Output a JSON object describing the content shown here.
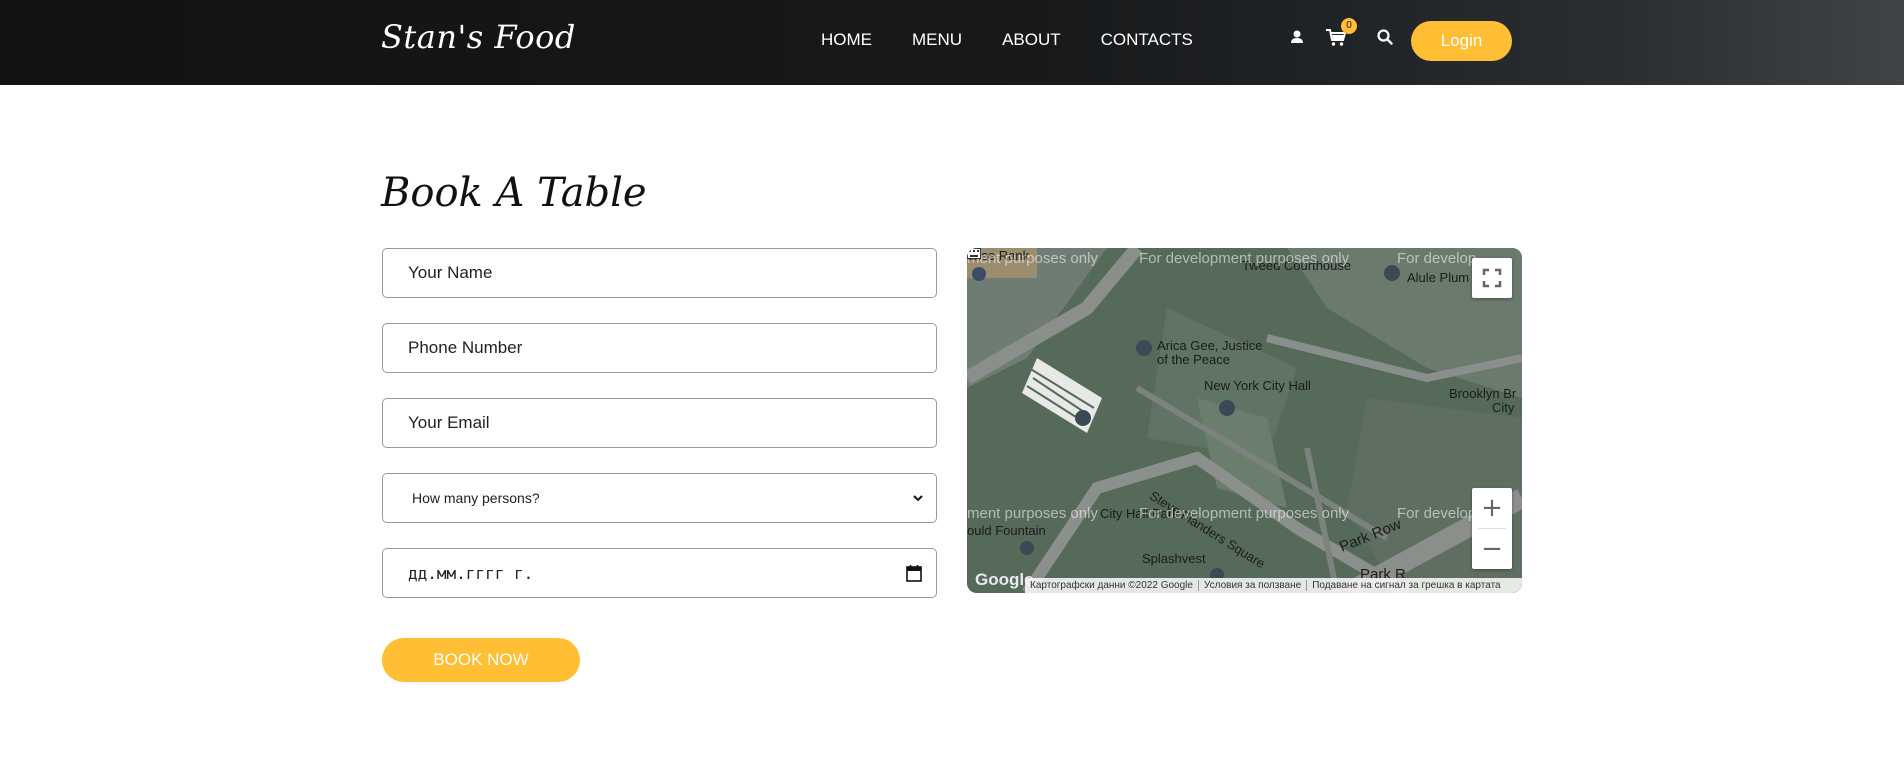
{
  "header": {
    "brand": "Stan's Food",
    "nav": [
      "HOME",
      "MENU",
      "ABOUT",
      "CONTACTS"
    ],
    "cart_count": "0",
    "login_label": "Login",
    "icons": [
      "user-icon",
      "cart-icon",
      "search-icon"
    ],
    "accent": "#ffbe33"
  },
  "booking": {
    "title": "Book A Table",
    "name_placeholder": "Your Name",
    "phone_placeholder": "Phone Number",
    "email_placeholder": "Your Email",
    "persons_selected": "How many persons?",
    "date_placeholder": "дд.мм.гггг г.",
    "book_label": "BOOK NOW"
  },
  "map": {
    "labels": {
      "poi1": "Arica Gee, Justice",
      "poi1b": "of the Peace",
      "poi2": "New York City Hall",
      "poi3": "Brooklyn Br",
      "poi3b": "City",
      "poi4": "Alule Plum",
      "poi5": "Tweed Courthouse",
      "poi6": "Steve Flanders Square",
      "poi7": "City Hall Park",
      "poi8": "Splashvest",
      "poi9": "Park Row",
      "poi10": "Park R",
      "poi11": "ould Fountain",
      "poi12": "arise Rank"
    },
    "dev_text": "For development purposes only",
    "dev_text_left": "ment purposes only",
    "dev_text_right": "For develop",
    "footer": [
      "Картографски данни ©2022 Google",
      "Условия за ползване",
      "Подаване на сигнал за грешка в картата"
    ],
    "logo": "Google",
    "zoom_in": "+",
    "zoom_out": "−"
  }
}
